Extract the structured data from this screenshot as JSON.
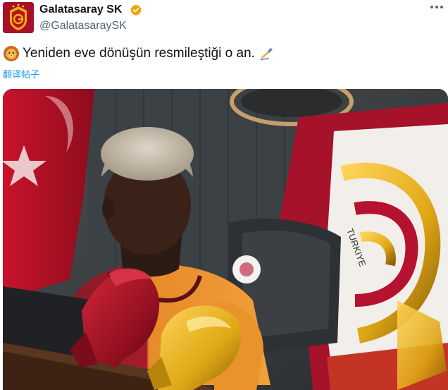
{
  "account": {
    "name": "Galatasaray SK",
    "handle": "@GalatasaraySK",
    "verified_icon": "verified-badge-icon",
    "verified_color": "#f4b400"
  },
  "post": {
    "text": "Yeniden eve dönüşün resmileştiği o an.",
    "leading_emoji": "lion-face-icon",
    "trailing_emoji": "writing-hand-icon",
    "translate_label": "翻译帖子"
  },
  "menu": {
    "more_icon": "more-options-icon"
  },
  "media": {
    "image_icon": "photo",
    "crest_text": "TURKIYE",
    "colors": {
      "red": "#b5122f",
      "gold": "#f2a900"
    }
  }
}
